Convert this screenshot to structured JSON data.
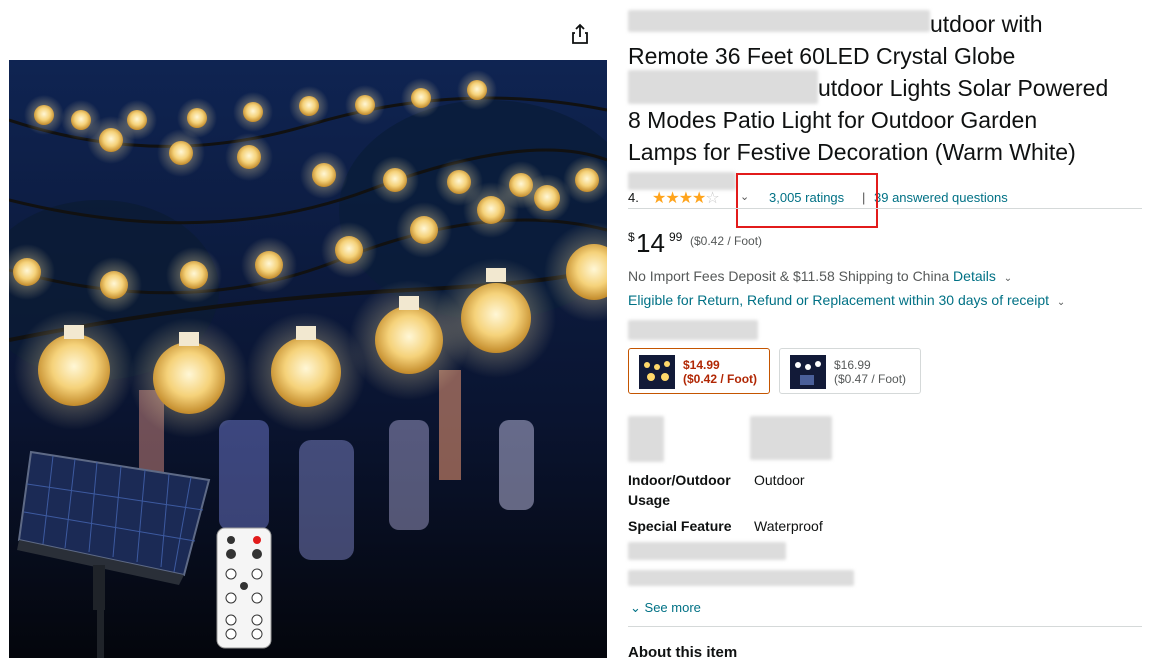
{
  "product": {
    "title_lines": [
      "utdoor with",
      "Remote 36 Feet 60LED Crystal Globe",
      "utdoor Lights Solar Powered",
      "8 Modes Patio Light for Outdoor Garden",
      "Lamps for Festive Decoration (Warm White)"
    ],
    "rating_value": "4.",
    "rating_stars": 4.5,
    "ratings_link": "3,005 ratings",
    "separator": "|",
    "questions_link": "39 answered questions"
  },
  "price": {
    "symbol": "$",
    "whole": "14",
    "fraction": "99",
    "unit": "($0.42 / Foot)"
  },
  "shipping": {
    "text": "No Import Fees Deposit & $11.58 Shipping to China",
    "details_link": "Details",
    "returns": "Eligible for Return, Refund or Replacement within 30 days of receipt"
  },
  "variants": [
    {
      "price": "$14.99",
      "unit": "($0.42 / Foot)"
    },
    {
      "price": "$16.99",
      "unit": "($0.47 / Foot)"
    }
  ],
  "specs": [
    {
      "label_line1": "Indoor/Outdoor",
      "label_line2": "Usage",
      "value": "Outdoor"
    },
    {
      "label_line1": "Special Feature",
      "label_line2": "",
      "value": "Waterproof"
    }
  ],
  "see_more": "See more",
  "about_title": "About this item",
  "colors": {
    "link": "#007185",
    "star": "#ffa41c",
    "price_highlight": "#b12704",
    "selected_border": "#c45500",
    "annotation_box": "#e21b1b"
  }
}
